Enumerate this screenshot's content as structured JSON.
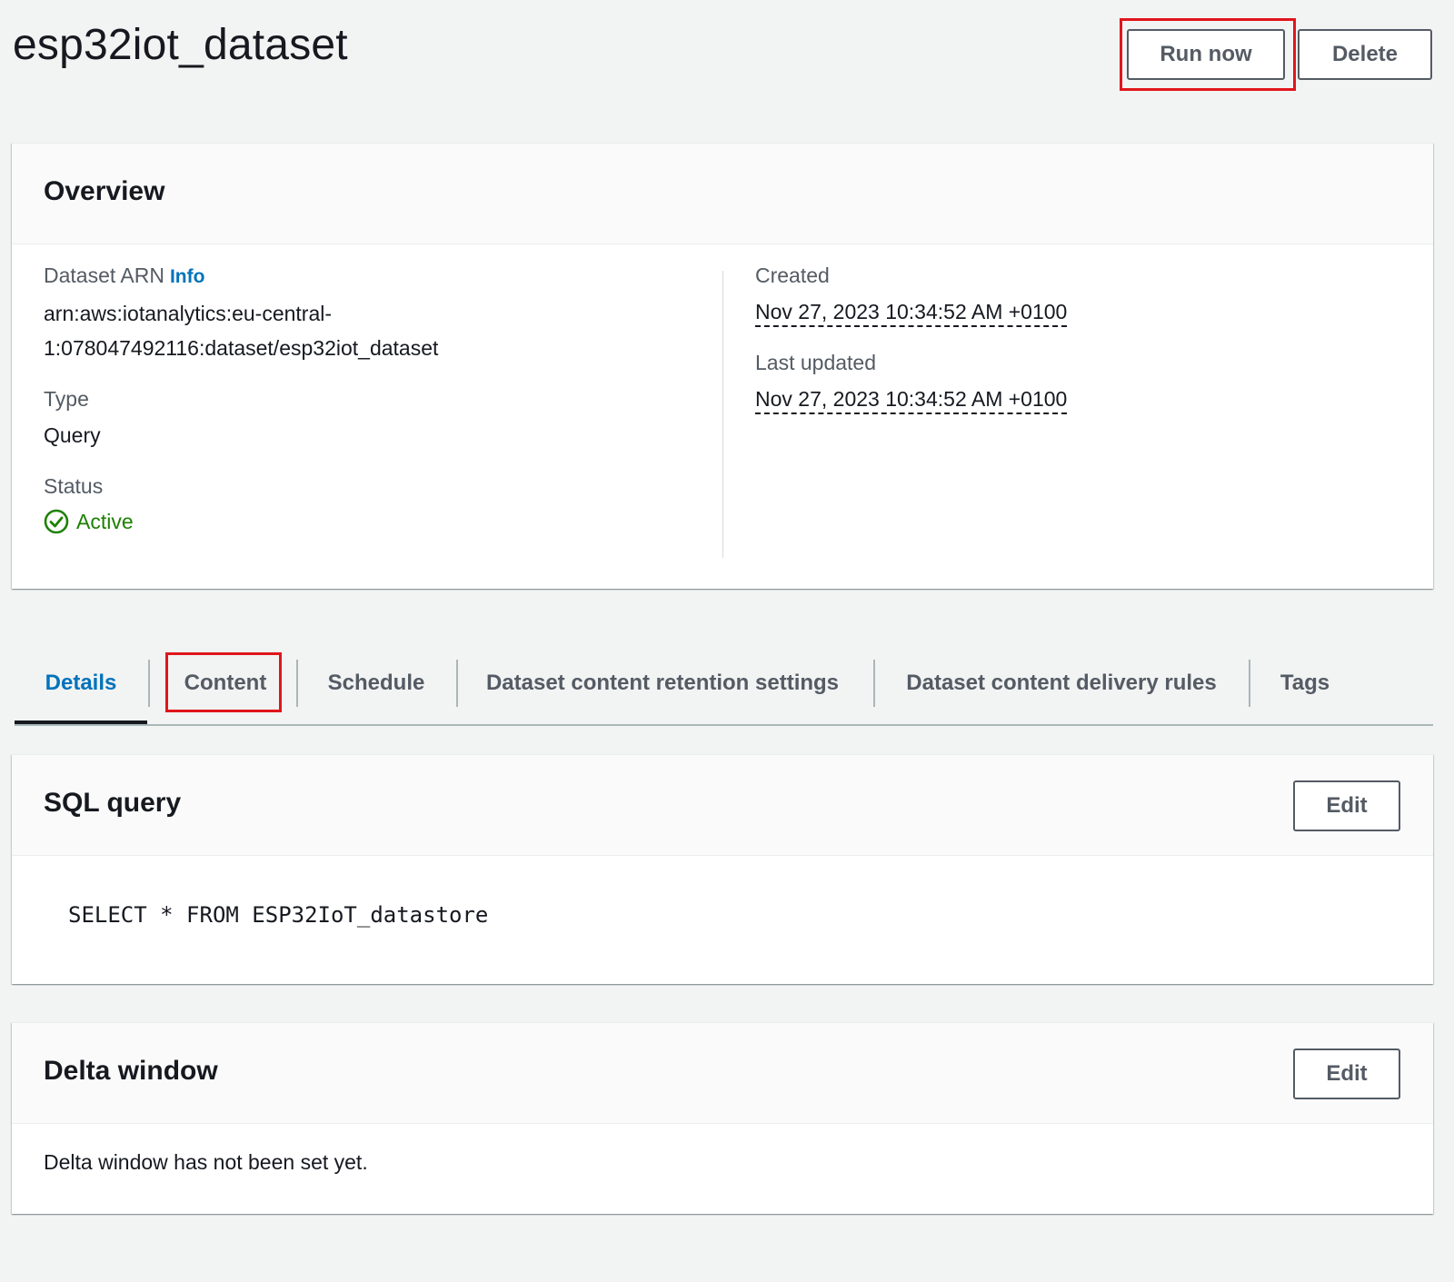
{
  "header": {
    "title": "esp32iot_dataset",
    "run_now_label": "Run now",
    "delete_label": "Delete"
  },
  "overview": {
    "title": "Overview",
    "arn_label": "Dataset ARN",
    "info_label": "Info",
    "arn_line1": "arn:aws:iotanalytics:eu-central-",
    "arn_line2": "1:078047492116:dataset/esp32iot_dataset",
    "type_label": "Type",
    "type_value": "Query",
    "status_label": "Status",
    "status_value": "Active",
    "created_label": "Created",
    "created_value": "Nov 27, 2023 10:34:52 AM +0100",
    "updated_label": "Last updated",
    "updated_value": "Nov 27, 2023 10:34:52 AM +0100"
  },
  "tabs": [
    {
      "label": "Details",
      "active": true
    },
    {
      "label": "Content",
      "active": false
    },
    {
      "label": "Schedule",
      "active": false
    },
    {
      "label": "Dataset content retention settings",
      "active": false
    },
    {
      "label": "Dataset content delivery rules",
      "active": false
    },
    {
      "label": "Tags",
      "active": false
    }
  ],
  "sql_query": {
    "title": "SQL query",
    "edit_label": "Edit",
    "query": "SELECT * FROM ESP32IoT_datastore"
  },
  "delta_window": {
    "title": "Delta window",
    "edit_label": "Edit",
    "message": "Delta window has not been set yet."
  },
  "colors": {
    "link": "#0073bb",
    "status_ok": "#1d8102",
    "highlight": "#e0161b",
    "background": "#f2f3f3"
  }
}
